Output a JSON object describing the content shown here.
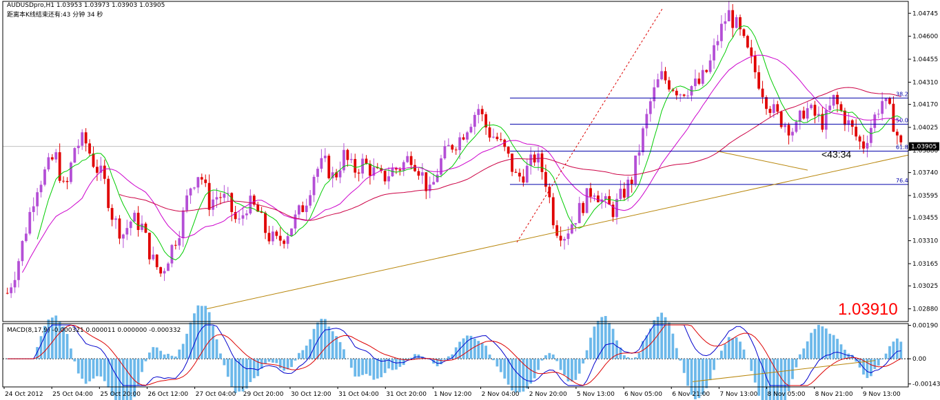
{
  "header": {
    "symbol_line": "AUDUSDpro,H1  1.03953 1.03973 1.03903 1.03905",
    "bar_countdown_line": "距离本K线结束还有:43 分钟 34 秒"
  },
  "countdown": "<43:34",
  "big_price": "1.03910",
  "colors": {
    "bull_candle": "#b44fd6",
    "bear_candle": "#e00000",
    "ma_fast": "#00cc00",
    "ma_mid": "#cc00cc",
    "ma_slow": "#cc0044",
    "fib_line": "#0000aa",
    "trendline": "#b8860b",
    "macd_hist": "#6cb8ea",
    "macd_main": "#0000cc",
    "macd_signal": "#dd0000"
  },
  "chart_data": [
    {
      "type": "candlestick",
      "title": "AUDUSDpro,H1",
      "ylim": [
        1.028,
        1.0482
      ],
      "y_ticks": [
        "1.04745",
        "1.04600",
        "1.04455",
        "1.04310",
        "1.04170",
        "1.04025",
        "1.03880",
        "1.03740",
        "1.03595",
        "1.03455",
        "1.03310",
        "1.03165",
        "1.03025",
        "1.02880"
      ],
      "current_price_label": "1.03905",
      "x_tick_labels": [
        "24 Oct 2012",
        "25 Oct 04:00",
        "25 Oct 20:00",
        "26 Oct 12:00",
        "27 Oct 04:00",
        "29 Oct 20:00",
        "30 Oct 12:00",
        "31 Oct 04:00",
        "31 Oct 20:00",
        "1 Nov 12:00",
        "2 Nov 04:00",
        "2 Nov 20:00",
        "5 Nov 13:00",
        "6 Nov 05:00",
        "6 Nov 21:00",
        "7 Nov 13:00",
        "8 Nov 05:00",
        "8 Nov 21:00",
        "9 Nov 13:00"
      ],
      "fibonacci_levels": [
        {
          "label": "38.2",
          "price": 1.0421
        },
        {
          "label": "50.0",
          "price": 1.04045
        },
        {
          "label": "61.8",
          "price": 1.03875
        },
        {
          "label": "76.4",
          "price": 1.03665
        }
      ],
      "price_path": [
        1.0298,
        1.0315,
        1.034,
        1.0365,
        1.0375,
        1.0385,
        1.036,
        1.039,
        1.0395,
        1.038,
        1.037,
        1.0345,
        1.0335,
        1.0345,
        1.034,
        1.032,
        1.031,
        1.0325,
        1.034,
        1.0365,
        1.0375,
        1.0355,
        1.036,
        1.0355,
        1.034,
        1.0355,
        1.035,
        1.0335,
        1.033,
        1.0335,
        1.0345,
        1.0355,
        1.0375,
        1.038,
        1.037,
        1.0385,
        1.0375,
        1.038,
        1.0375,
        1.037,
        1.0375,
        1.0378,
        1.0385,
        1.0375,
        1.036,
        1.038,
        1.039,
        1.0395,
        1.0405,
        1.0415,
        1.04,
        1.0395,
        1.0385,
        1.037,
        1.0375,
        1.0385,
        1.037,
        1.034,
        1.0335,
        1.0345,
        1.0355,
        1.0365,
        1.0355,
        1.035,
        1.036,
        1.037,
        1.0395,
        1.042,
        1.0435,
        1.043,
        1.0425,
        1.0428,
        1.043,
        1.044,
        1.046,
        1.0475,
        1.0465,
        1.045,
        1.0435,
        1.042,
        1.041,
        1.0405,
        1.04,
        1.0415,
        1.041,
        1.0405,
        1.042,
        1.041,
        1.04,
        1.039,
        1.0405,
        1.042,
        1.041,
        1.039
      ],
      "trendlines": [
        {
          "name": "support",
          "from": [
            0.225,
            1.0288
          ],
          "to": [
            1.0,
            1.0385
          ]
        }
      ]
    },
    {
      "type": "macd",
      "title": "MACD(8,17,9) -0.000321 0.000011 0.000000 -0.000332",
      "y_ticks": [
        "0.00190",
        "0.00",
        "-0.00143"
      ],
      "ylim": [
        -0.0016,
        0.002
      ]
    }
  ]
}
